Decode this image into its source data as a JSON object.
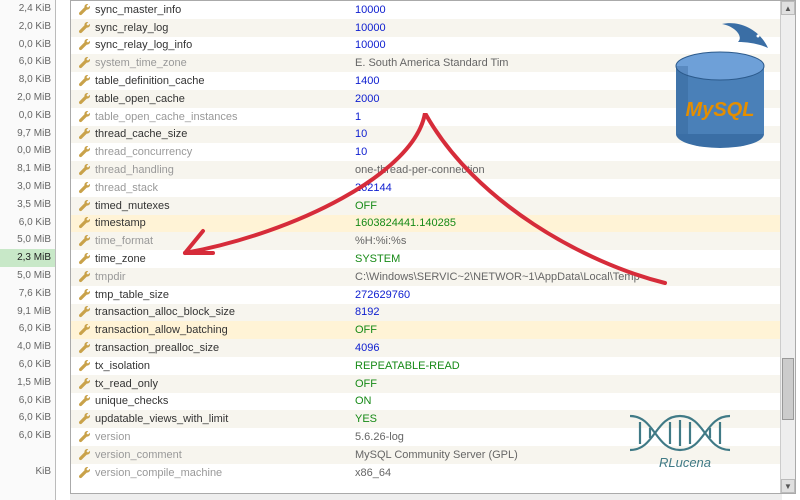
{
  "leftSizes": [
    {
      "t": "2,4 KiB"
    },
    {
      "t": "2,0 KiB"
    },
    {
      "t": "0,0 KiB"
    },
    {
      "t": "6,0 KiB"
    },
    {
      "t": "8,0 KiB"
    },
    {
      "t": "2,0 MiB"
    },
    {
      "t": "0,0 KiB"
    },
    {
      "t": "9,7 MiB"
    },
    {
      "t": "0,0 MiB"
    },
    {
      "t": "8,1 MiB"
    },
    {
      "t": "3,0 MiB"
    },
    {
      "t": "3,5 MiB"
    },
    {
      "t": "6,0 KiB"
    },
    {
      "t": "5,0 MiB"
    },
    {
      "t": "2,3 MiB",
      "hl": true
    },
    {
      "t": "5,0 MiB"
    },
    {
      "t": "7,6 KiB"
    },
    {
      "t": "9,1 MiB"
    },
    {
      "t": "6,0 KiB"
    },
    {
      "t": "4,0 MiB"
    },
    {
      "t": "6,0 KiB"
    },
    {
      "t": "1,5 MiB"
    },
    {
      "t": "6,0 KiB"
    },
    {
      "t": "6,0 KiB"
    },
    {
      "t": "6,0 KiB"
    },
    {
      "t": ""
    },
    {
      "t": "KiB"
    },
    {
      "t": ""
    }
  ],
  "vars": [
    {
      "name": "sync_master_info",
      "val": "10000",
      "cls": "num"
    },
    {
      "name": "sync_relay_log",
      "val": "10000",
      "cls": "num"
    },
    {
      "name": "sync_relay_log_info",
      "val": "10000",
      "cls": "num"
    },
    {
      "name": "system_time_zone",
      "val": "E. South America Standard Tim",
      "cls": "txt",
      "grey": true
    },
    {
      "name": "table_definition_cache",
      "val": "1400",
      "cls": "num"
    },
    {
      "name": "table_open_cache",
      "val": "2000",
      "cls": "num"
    },
    {
      "name": "table_open_cache_instances",
      "val": "1",
      "cls": "num",
      "grey": true
    },
    {
      "name": "thread_cache_size",
      "val": "10",
      "cls": "num"
    },
    {
      "name": "thread_concurrency",
      "val": "10",
      "cls": "num",
      "grey": true
    },
    {
      "name": "thread_handling",
      "val": "one-thread-per-connection",
      "cls": "txt",
      "grey": true
    },
    {
      "name": "thread_stack",
      "val": "262144",
      "cls": "num",
      "grey": true
    },
    {
      "name": "timed_mutexes",
      "val": "OFF",
      "cls": "green"
    },
    {
      "name": "timestamp",
      "val": "1603824441.140285",
      "cls": "green",
      "hl": true
    },
    {
      "name": "time_format",
      "val": "%H:%i:%s",
      "cls": "txt",
      "grey": true
    },
    {
      "name": "time_zone",
      "val": "SYSTEM",
      "cls": "green"
    },
    {
      "name": "tmpdir",
      "val": "C:\\Windows\\SERVIC~2\\NETWOR~1\\AppData\\Local\\Temp",
      "cls": "txt",
      "grey": true
    },
    {
      "name": "tmp_table_size",
      "val": "272629760",
      "cls": "num"
    },
    {
      "name": "transaction_alloc_block_size",
      "val": "8192",
      "cls": "num"
    },
    {
      "name": "transaction_allow_batching",
      "val": "OFF",
      "cls": "green",
      "hl": true
    },
    {
      "name": "transaction_prealloc_size",
      "val": "4096",
      "cls": "num"
    },
    {
      "name": "tx_isolation",
      "val": "REPEATABLE-READ",
      "cls": "green"
    },
    {
      "name": "tx_read_only",
      "val": "OFF",
      "cls": "green"
    },
    {
      "name": "unique_checks",
      "val": "ON",
      "cls": "green"
    },
    {
      "name": "updatable_views_with_limit",
      "val": "YES",
      "cls": "green"
    },
    {
      "name": "version",
      "val": "5.6.26-log",
      "cls": "txt",
      "grey": true
    },
    {
      "name": "version_comment",
      "val": "MySQL Community Server (GPL)",
      "cls": "txt",
      "grey": true
    },
    {
      "name": "version_compile_machine",
      "val": "x86_64",
      "cls": "txt",
      "grey": true
    }
  ],
  "watermark": "RLucena",
  "mysqlLabel": "MySQL",
  "colors": {
    "annotation": "#d62c3a",
    "mysqlBlue": "#3a6ea5",
    "mysqlOrange": "#e48e00"
  }
}
